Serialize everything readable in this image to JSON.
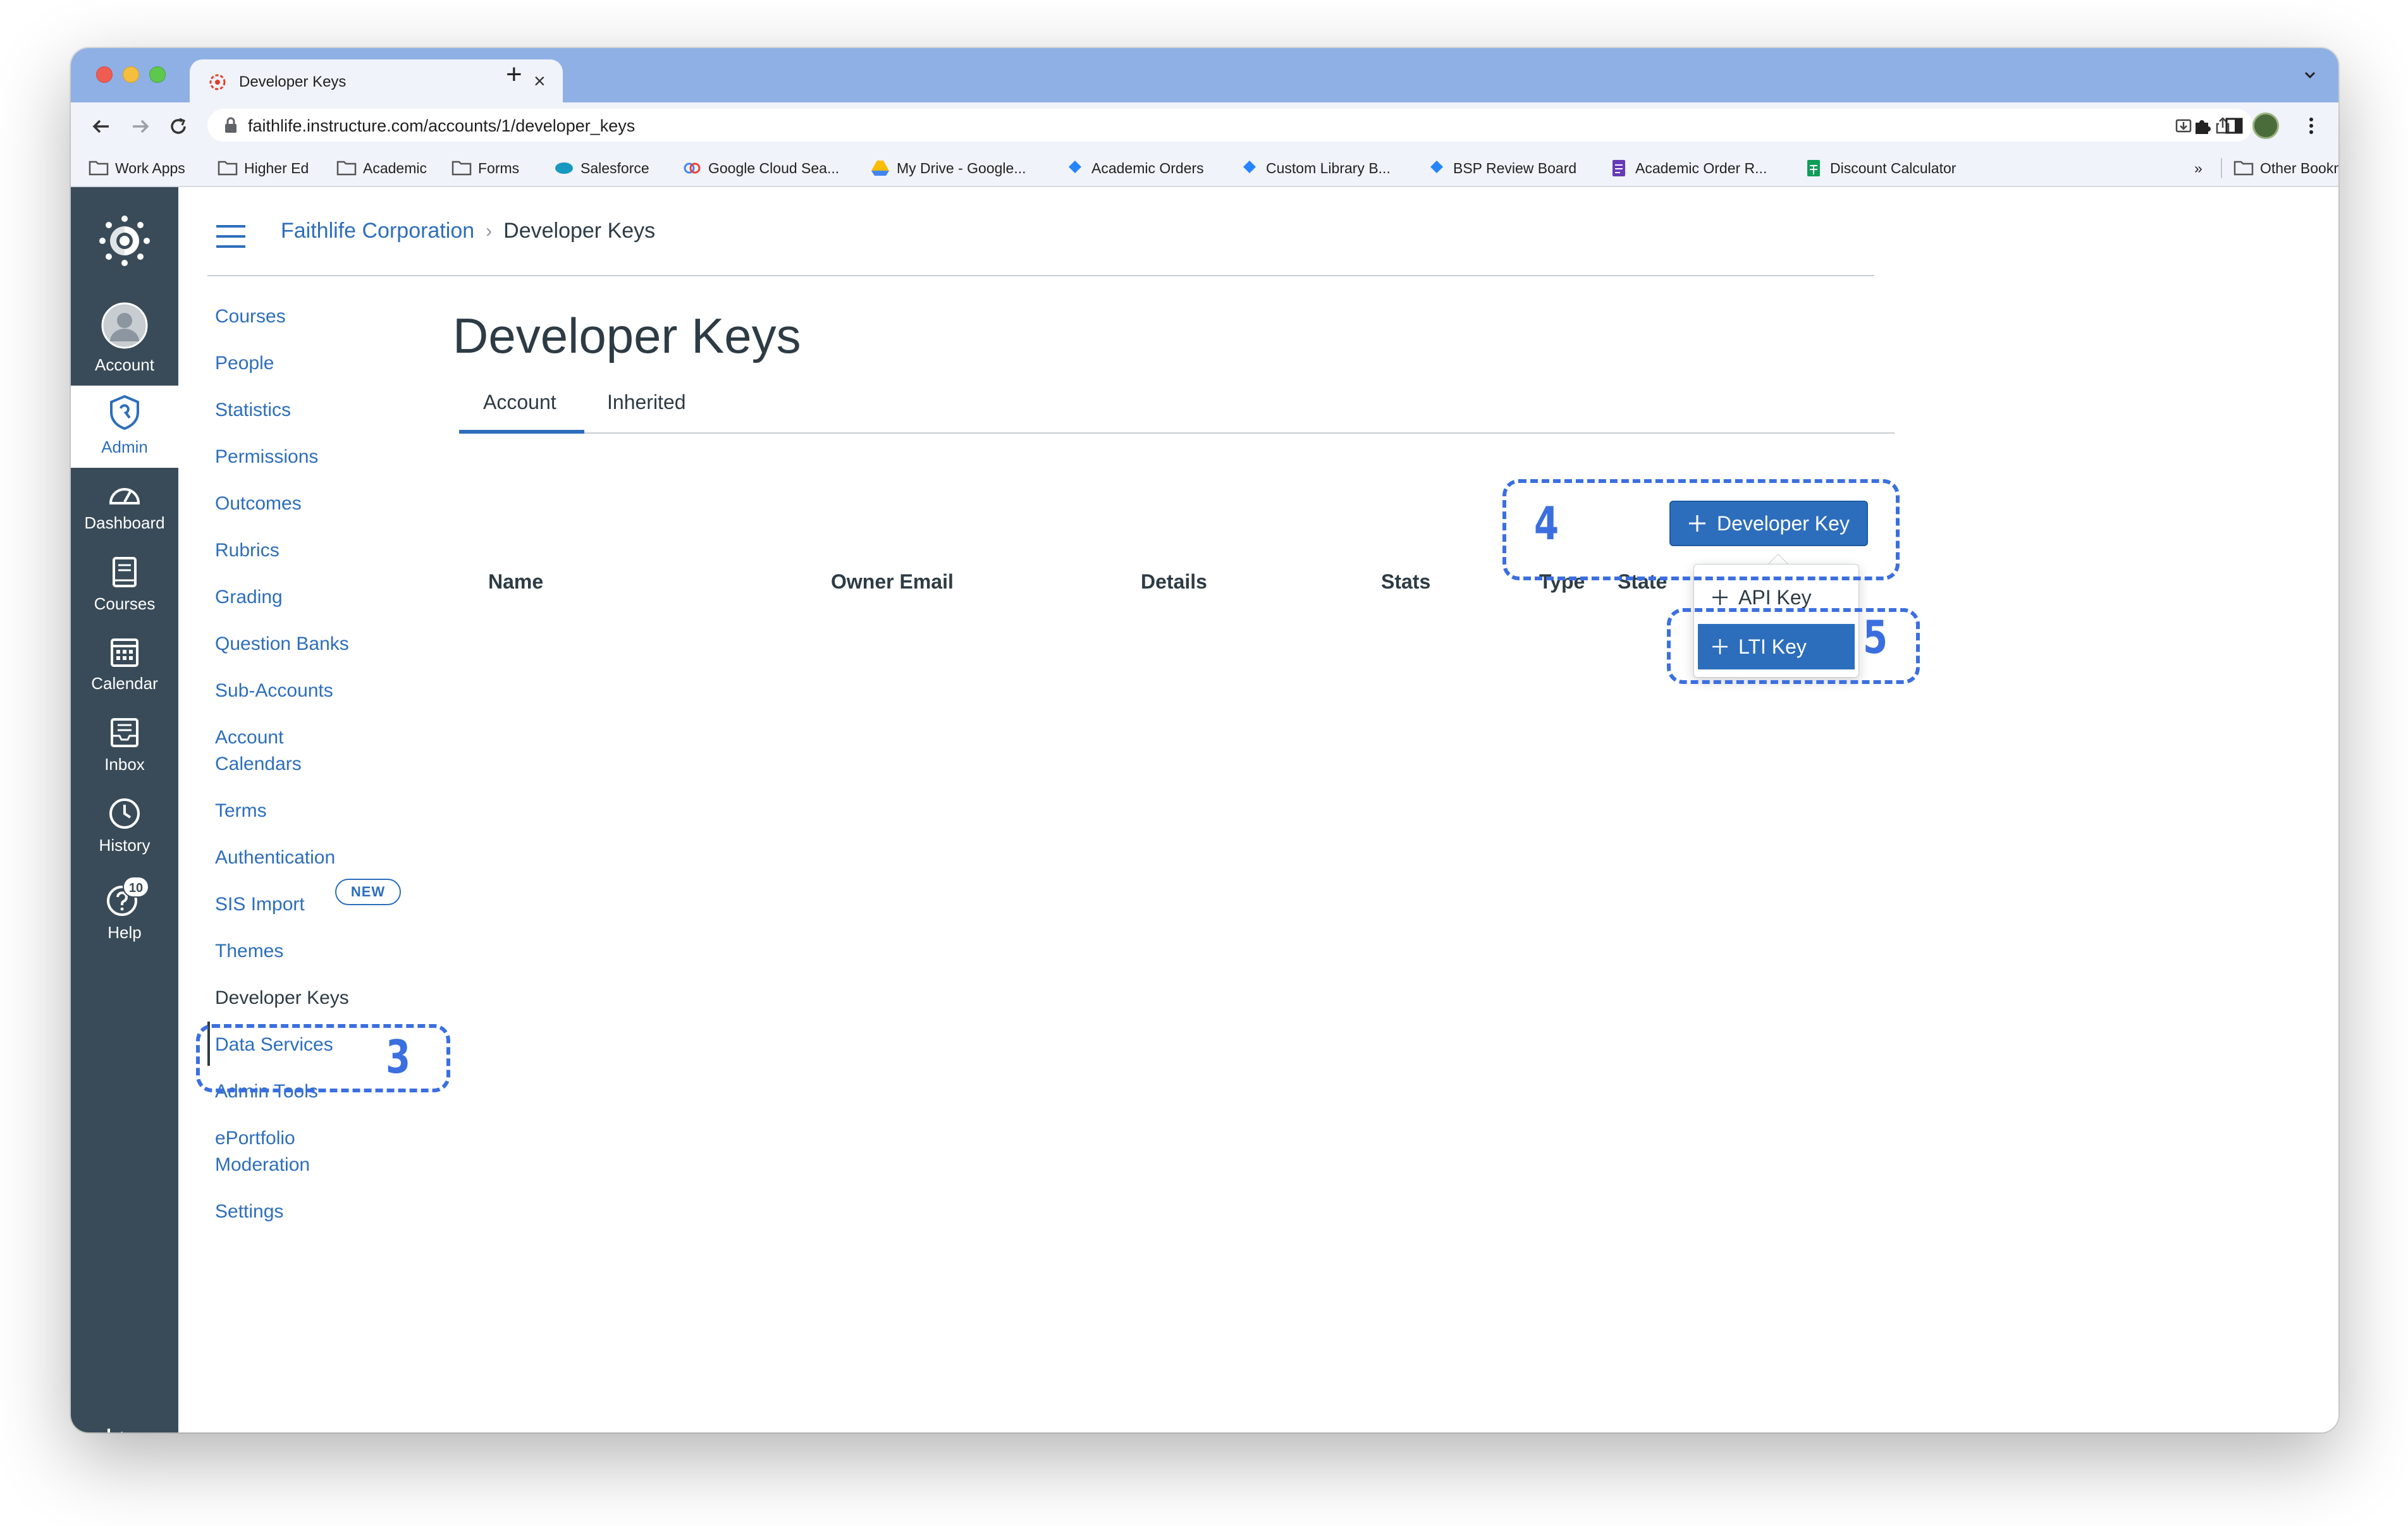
{
  "browser": {
    "tab_title": "Developer Keys",
    "new_tab_symbol": "+",
    "close_symbol": "×",
    "url": "faithlife.instructure.com/accounts/1/developer_keys"
  },
  "bookmarks": [
    {
      "label": "Work Apps",
      "icon": "folder-icon"
    },
    {
      "label": "Higher Ed",
      "icon": "folder-icon"
    },
    {
      "label": "Academic",
      "icon": "folder-icon"
    },
    {
      "label": "Forms",
      "icon": "folder-icon"
    },
    {
      "label": "Salesforce",
      "icon": "salesforce-icon"
    },
    {
      "label": "Google Cloud Sea...",
      "icon": "google-cloud-icon"
    },
    {
      "label": "My Drive - Google...",
      "icon": "google-drive-icon"
    },
    {
      "label": "Academic Orders",
      "icon": "jira-icon"
    },
    {
      "label": "Custom Library B...",
      "icon": "jira-icon"
    },
    {
      "label": "BSP Review Board",
      "icon": "jira-icon"
    },
    {
      "label": "Academic Order R...",
      "icon": "forms-icon"
    },
    {
      "label": "Discount Calculator",
      "icon": "sheets-icon"
    }
  ],
  "bookmarks_overflow": "»",
  "other_bookmarks": "Other Bookmarks",
  "global_nav": {
    "account": "Account",
    "admin": "Admin",
    "dashboard": "Dashboard",
    "courses": "Courses",
    "calendar": "Calendar",
    "inbox": "Inbox",
    "history": "History",
    "help": "Help",
    "help_badge": "10"
  },
  "breadcrumb": {
    "root": "Faithlife Corporation",
    "separator": "›",
    "current": "Developer Keys"
  },
  "account_nav": {
    "courses": "Courses",
    "people": "People",
    "statistics": "Statistics",
    "permissions": "Permissions",
    "outcomes": "Outcomes",
    "rubrics": "Rubrics",
    "grading": "Grading",
    "question_banks": "Question Banks",
    "sub_accounts": "Sub-Accounts",
    "account_calendars_1": "Account",
    "account_calendars_2": "Calendars",
    "new_badge": "NEW",
    "terms": "Terms",
    "authentication": "Authentication",
    "sis_import": "SIS Import",
    "themes": "Themes",
    "developer_keys": "Developer Keys",
    "data_services": "Data Services",
    "admin_tools": "Admin Tools",
    "eportfolio_1": "ePortfolio",
    "eportfolio_2": "Moderation",
    "settings": "Settings"
  },
  "main": {
    "title": "Developer Keys",
    "tabs": [
      {
        "label": "Account",
        "selected": true
      },
      {
        "label": "Inherited",
        "selected": false
      }
    ],
    "table_headers": [
      "Name",
      "Owner Email",
      "Details",
      "Stats",
      "Type",
      "State"
    ],
    "add_button": "Developer Key",
    "menu": {
      "api_key": "API Key",
      "lti_key": "LTI Key"
    }
  },
  "callouts": {
    "step3": "3",
    "step4": "4",
    "step5": "5"
  },
  "colors": {
    "brand_blue": "#2d6ebc",
    "nav_dark": "#394b58",
    "callout_blue": "#3b6fe0",
    "tabstrip": "#8fb0e4"
  }
}
